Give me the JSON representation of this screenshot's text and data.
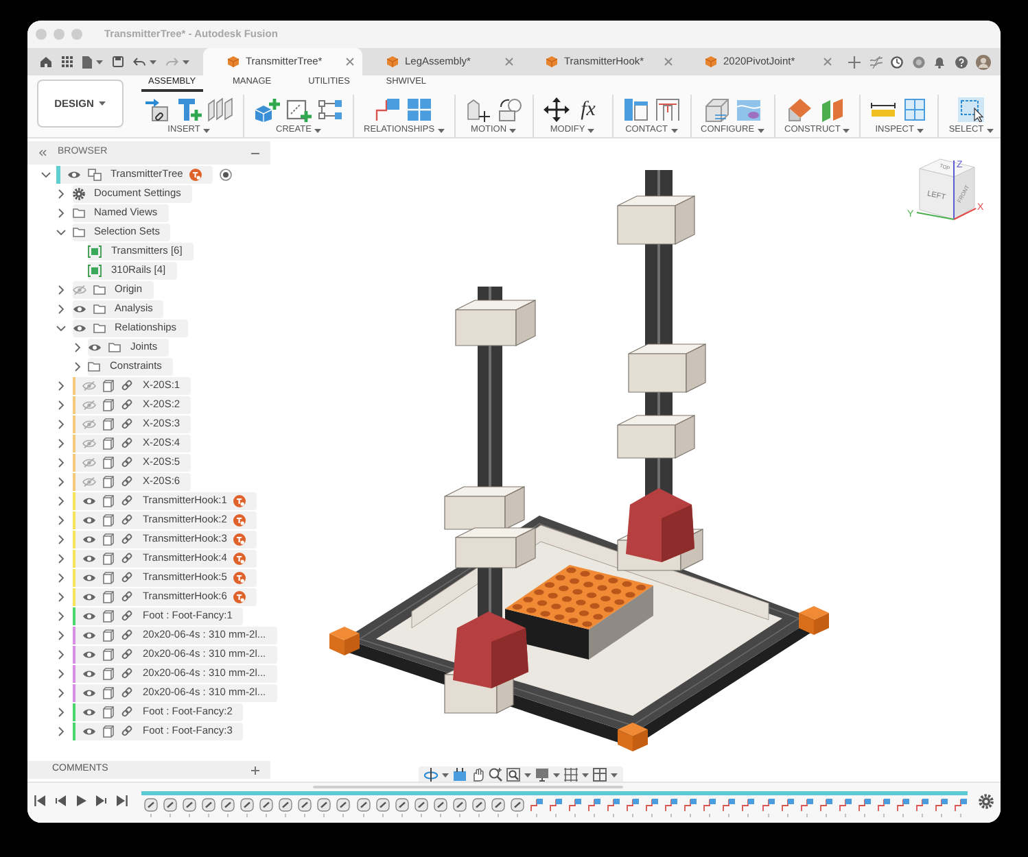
{
  "window": {
    "title": "TransmitterTree* - Autodesk Fusion"
  },
  "document_tabs": [
    {
      "label": "TransmitterTree*",
      "selected": true
    },
    {
      "label": "LegAssembly*",
      "selected": false
    },
    {
      "label": "TransmitterHook*",
      "selected": false
    },
    {
      "label": "2020PivotJoint*",
      "selected": false
    }
  ],
  "toolbar": {
    "workspace": "DESIGN",
    "tabs": [
      {
        "label": "ASSEMBLY",
        "selected": true
      },
      {
        "label": "MANAGE",
        "selected": false
      },
      {
        "label": "UTILITIES",
        "selected": false
      },
      {
        "label": "SHWIVEL",
        "selected": false
      }
    ],
    "groups": [
      {
        "label": "INSERT"
      },
      {
        "label": "CREATE"
      },
      {
        "label": "RELATIONSHIPS"
      },
      {
        "label": "MOTION"
      },
      {
        "label": "MODIFY",
        "glyph": "fx"
      },
      {
        "label": "CONTACT"
      },
      {
        "label": "CONFIGURE"
      },
      {
        "label": "CONSTRUCT"
      },
      {
        "label": "INSPECT"
      },
      {
        "label": "SELECT"
      }
    ]
  },
  "browser": {
    "title": "BROWSER",
    "tree": [
      {
        "label": "TransmitterTree",
        "kind": "root",
        "expanded": true,
        "visible": true,
        "color": "#5fcfcf",
        "badge": true,
        "children": [
          {
            "label": "Document Settings",
            "kind": "settings",
            "expanded": false
          },
          {
            "label": "Named Views",
            "kind": "folder",
            "expanded": false
          },
          {
            "label": "Selection Sets",
            "kind": "folder",
            "expanded": true,
            "children": [
              {
                "label": "Transmitters [6]",
                "kind": "selection-set"
              },
              {
                "label": "310Rails [4]",
                "kind": "selection-set"
              }
            ]
          },
          {
            "label": "Origin",
            "kind": "folder",
            "expanded": false,
            "visible": false
          },
          {
            "label": "Analysis",
            "kind": "folder",
            "expanded": false,
            "visible": true
          },
          {
            "label": "Relationships",
            "kind": "folder",
            "expanded": true,
            "visible": true,
            "children": [
              {
                "label": "Joints",
                "kind": "folder",
                "expanded": false,
                "visible": true
              },
              {
                "label": "Constraints",
                "kind": "folder",
                "expanded": false
              }
            ]
          },
          {
            "label": "X-20S:1",
            "kind": "component",
            "expanded": false,
            "visible": false,
            "color": "#f5c97a"
          },
          {
            "label": "X-20S:2",
            "kind": "component",
            "expanded": false,
            "visible": false,
            "color": "#f5c97a"
          },
          {
            "label": "X-20S:3",
            "kind": "component",
            "expanded": false,
            "visible": false,
            "color": "#f5c97a"
          },
          {
            "label": "X-20S:4",
            "kind": "component",
            "expanded": false,
            "visible": false,
            "color": "#f5c97a"
          },
          {
            "label": "X-20S:5",
            "kind": "component",
            "expanded": false,
            "visible": false,
            "color": "#f5c97a"
          },
          {
            "label": "X-20S:6",
            "kind": "component",
            "expanded": false,
            "visible": false,
            "color": "#f5c97a"
          },
          {
            "label": "TransmitterHook:1",
            "kind": "component",
            "expanded": false,
            "visible": true,
            "color": "#f7e35a",
            "badge": true
          },
          {
            "label": "TransmitterHook:2",
            "kind": "component",
            "expanded": false,
            "visible": true,
            "color": "#f7e35a",
            "badge": true
          },
          {
            "label": "TransmitterHook:3",
            "kind": "component",
            "expanded": false,
            "visible": true,
            "color": "#f7e35a",
            "badge": true
          },
          {
            "label": "TransmitterHook:4",
            "kind": "component",
            "expanded": false,
            "visible": true,
            "color": "#f7e35a",
            "badge": true
          },
          {
            "label": "TransmitterHook:5",
            "kind": "component",
            "expanded": false,
            "visible": true,
            "color": "#f7e35a",
            "badge": true
          },
          {
            "label": "TransmitterHook:6",
            "kind": "component",
            "expanded": false,
            "visible": true,
            "color": "#f7e35a",
            "badge": true
          },
          {
            "label": "Foot : Foot-Fancy:1",
            "kind": "component",
            "expanded": false,
            "visible": true,
            "color": "#4ad66d"
          },
          {
            "label": "20x20-06-4s : 310 mm-2l...",
            "kind": "component",
            "expanded": false,
            "visible": true,
            "color": "#d98ee6"
          },
          {
            "label": "20x20-06-4s : 310 mm-2l...",
            "kind": "component",
            "expanded": false,
            "visible": true,
            "color": "#d98ee6"
          },
          {
            "label": "20x20-06-4s : 310 mm-2l...",
            "kind": "component",
            "expanded": false,
            "visible": true,
            "color": "#d98ee6"
          },
          {
            "label": "20x20-06-4s : 310 mm-2l...",
            "kind": "component",
            "expanded": false,
            "visible": true,
            "color": "#d98ee6"
          },
          {
            "label": "Foot : Foot-Fancy:2",
            "kind": "component",
            "expanded": false,
            "visible": true,
            "color": "#4ad66d"
          },
          {
            "label": "Foot : Foot-Fancy:3",
            "kind": "component",
            "expanded": false,
            "visible": true,
            "color": "#4ad66d"
          }
        ]
      }
    ]
  },
  "comments": {
    "title": "COMMENTS"
  },
  "view_cube": {
    "top": "TOP",
    "left": "LEFT",
    "front": "FRONT",
    "z": "Z",
    "x": "X",
    "y": "Y"
  },
  "timeline": {
    "items": [
      {
        "kind": "insert"
      },
      {
        "kind": "insert"
      },
      {
        "kind": "insert"
      },
      {
        "kind": "insert"
      },
      {
        "kind": "insert"
      },
      {
        "kind": "insert"
      },
      {
        "kind": "insert"
      },
      {
        "kind": "insert"
      },
      {
        "kind": "insert"
      },
      {
        "kind": "insert"
      },
      {
        "kind": "insert"
      },
      {
        "kind": "insert"
      },
      {
        "kind": "insert"
      },
      {
        "kind": "insert"
      },
      {
        "kind": "insert"
      },
      {
        "kind": "insert"
      },
      {
        "kind": "insert"
      },
      {
        "kind": "insert"
      },
      {
        "kind": "insert"
      },
      {
        "kind": "insert"
      },
      {
        "kind": "joint"
      },
      {
        "kind": "joint"
      },
      {
        "kind": "joint"
      },
      {
        "kind": "joint"
      },
      {
        "kind": "joint"
      },
      {
        "kind": "joint"
      },
      {
        "kind": "joint"
      },
      {
        "kind": "joint"
      },
      {
        "kind": "joint"
      },
      {
        "kind": "joint"
      },
      {
        "kind": "joint"
      },
      {
        "kind": "joint"
      },
      {
        "kind": "joint"
      },
      {
        "kind": "joint"
      },
      {
        "kind": "joint"
      },
      {
        "kind": "joint"
      },
      {
        "kind": "joint"
      },
      {
        "kind": "joint"
      },
      {
        "kind": "joint"
      },
      {
        "kind": "joint"
      },
      {
        "kind": "joint"
      },
      {
        "kind": "joint"
      },
      {
        "kind": "joint"
      }
    ]
  }
}
